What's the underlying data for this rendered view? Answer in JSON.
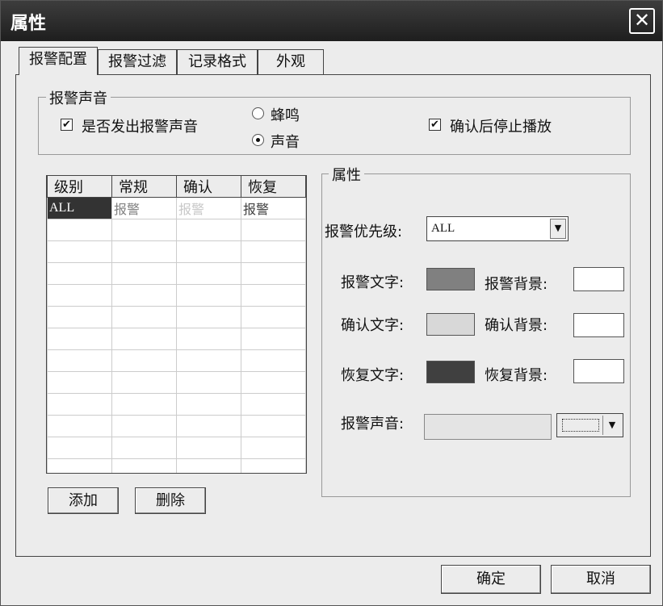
{
  "window": {
    "title": "属性",
    "close_glyph": "✕"
  },
  "tabs": [
    {
      "label": "报警配置",
      "active": true
    },
    {
      "label": "报警过滤",
      "active": false
    },
    {
      "label": "记录格式",
      "active": false
    },
    {
      "label": "外观",
      "active": false
    }
  ],
  "alarm_sound_group": {
    "title": "报警声音",
    "play_sound": {
      "label": "是否发出报警声音",
      "checked": true
    },
    "buzzer": {
      "label": "蜂鸣",
      "selected": false
    },
    "sound": {
      "label": "声音",
      "selected": true
    },
    "stop_after_ack": {
      "label": "确认后停止播放",
      "checked": true
    }
  },
  "levels_grid": {
    "columns": [
      "级别",
      "常规",
      "确认",
      "恢复"
    ],
    "rows": [
      [
        "ALL",
        "报警",
        "报警",
        "报警"
      ]
    ],
    "cell_colors": [
      "#ffffff",
      "#808080",
      "#c8c8c8",
      "#404040"
    ]
  },
  "buttons": {
    "add": "添加",
    "delete": "删除",
    "ok": "确定",
    "cancel": "取消"
  },
  "properties_group": {
    "title": "属性",
    "priority_label": "报警优先级:",
    "priority_value": "ALL",
    "alarm_text_label": "报警文字:",
    "alarm_bg_label": "报警背景:",
    "ack_text_label": "确认文字:",
    "ack_bg_label": "确认背景:",
    "restore_text_label": "恢复文字:",
    "restore_bg_label": "恢复背景:",
    "sound_label": "报警声音:",
    "sound_value": "",
    "colors": {
      "alarm_text": "#808080",
      "ack_text": "#d8d8d8",
      "restore_text": "#404040"
    }
  }
}
